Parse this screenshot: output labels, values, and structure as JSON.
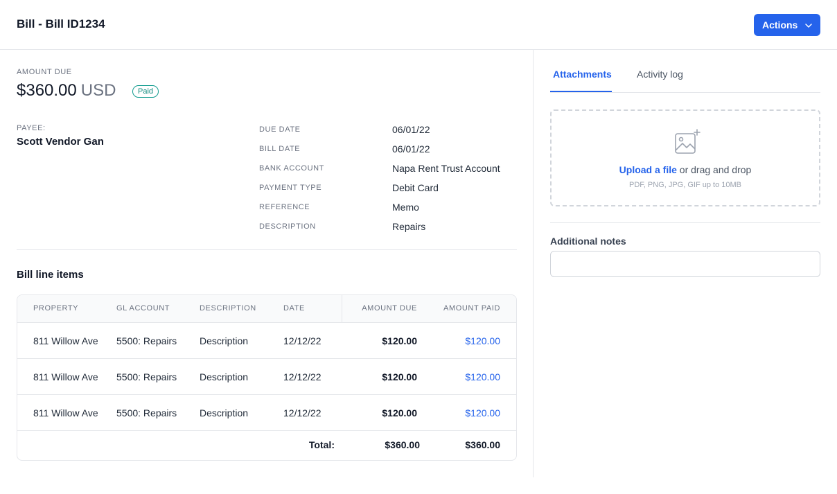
{
  "header": {
    "title": "Bill - Bill ID1234",
    "actions_label": "Actions"
  },
  "summary": {
    "amount_due_label": "AMOUNT DUE",
    "amount": "$360.00",
    "currency": "USD",
    "status": "Paid",
    "status_color": "#0f9b8e",
    "payee_label": "PAYEE:",
    "payee_name": "Scott Vendor Gan"
  },
  "details": [
    {
      "key": "DUE DATE",
      "value": "06/01/22"
    },
    {
      "key": "BILL DATE",
      "value": "06/01/22"
    },
    {
      "key": "BANK ACCOUNT",
      "value": "Napa Rent Trust Account"
    },
    {
      "key": "PAYMENT TYPE",
      "value": "Debit Card"
    },
    {
      "key": "REFERENCE",
      "value": "Memo"
    },
    {
      "key": "DESCRIPTION",
      "value": "Repairs"
    }
  ],
  "line_items": {
    "title": "Bill line items",
    "columns": [
      "PROPERTY",
      "GL ACCOUNT",
      "DESCRIPTION",
      "DATE",
      "AMOUNT DUE",
      "AMOUNT PAID"
    ],
    "rows": [
      {
        "property": "811 Willow Ave",
        "gl_account": "5500: Repairs",
        "description": "Description",
        "date": "12/12/22",
        "amount_due": "$120.00",
        "amount_paid": "$120.00"
      },
      {
        "property": "811 Willow Ave",
        "gl_account": "5500: Repairs",
        "description": "Description",
        "date": "12/12/22",
        "amount_due": "$120.00",
        "amount_paid": "$120.00"
      },
      {
        "property": "811 Willow Ave",
        "gl_account": "5500: Repairs",
        "description": "Description",
        "date": "12/12/22",
        "amount_due": "$120.00",
        "amount_paid": "$120.00"
      }
    ],
    "total_label": "Total:",
    "total_due": "$360.00",
    "total_paid": "$360.00"
  },
  "sidebar": {
    "tabs": [
      {
        "label": "Attachments",
        "active": true
      },
      {
        "label": "Activity log",
        "active": false
      }
    ],
    "upload": {
      "link_text": "Upload a file",
      "rest_text": " or drag and drop",
      "hint": "PDF, PNG, JPG, GIF up to 10MB",
      "icon": "image-add-icon"
    },
    "notes_label": "Additional notes",
    "notes_value": ""
  },
  "colors": {
    "accent": "#2563eb",
    "border": "#e5e7eb"
  }
}
